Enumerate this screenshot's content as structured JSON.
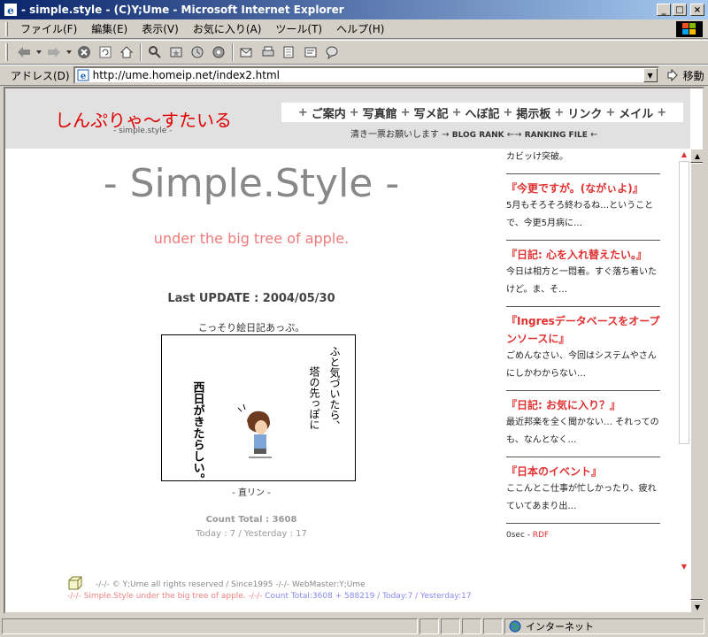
{
  "window": {
    "title": "- simple.style - (C)Y;Ume - Microsoft Internet Explorer",
    "min_label": "_",
    "max_label": "□",
    "close_label": "×"
  },
  "menu": {
    "items": [
      "ファイル(F)",
      "編集(E)",
      "表示(V)",
      "お気に入り(A)",
      "ツール(T)",
      "ヘルプ(H)"
    ]
  },
  "toolbar": {
    "icons": [
      "back-icon",
      "forward-icon",
      "stop-icon",
      "refresh-icon",
      "home-icon",
      "search-icon",
      "favorites-icon",
      "history-icon",
      "media-icon",
      "mail-icon",
      "print-icon",
      "edit-icon",
      "discuss-icon",
      "messenger-icon"
    ]
  },
  "address": {
    "label": "アドレス(D)",
    "url": "http://ume.homeip.net/index2.html",
    "go_label": "移動"
  },
  "site": {
    "logo": "しんぷりゃ〜すたいる",
    "logo_sub": "- simple.style -",
    "nav": [
      "+",
      "ご案内",
      "+",
      "写真館",
      "+",
      "写メ記",
      "+",
      "へぼ記",
      "+",
      "掲示板",
      "+",
      "リンク",
      "+",
      "メイル",
      "+"
    ],
    "header_line": "清き一票お願いします →",
    "blog_rank": "BLOG RANK",
    "arrow_mid": "←→",
    "ranking_file": "RANKING FILE",
    "arrow_end": "←"
  },
  "main": {
    "big_title": "- Simple.Style -",
    "subtitle": "under the big tree of apple.",
    "last_update": "Last UPDATE : 2004/05/30",
    "caption_top": "こっそり絵日記あっぷ。",
    "image_text_left": "西日がきたらしい。",
    "image_text_right1": "ふと気づいたら、",
    "image_text_right2": "塔の先っぽに",
    "caption_bottom": "- 直リン -",
    "count_total": "Count Total : 3608",
    "count_sub": "Today : 7 / Yesterday : 17"
  },
  "footer": {
    "line1": "-/-/- © Y;Ume all rights reserved / Since1995 -/-/- WebMaster:Y;Ume",
    "line2_pink": "-/-/- Simple.Style under the big tree of apple. -/-/-",
    "line2_blue": "Count Total:3608 + 588219 / Today:7 / Yesterday:17"
  },
  "sidebar": {
    "first_body": "カビッけ突破。",
    "entries": [
      {
        "title": "『今更ですが。(ながぃよ)』",
        "body": "5月もそろそろ終わるね…ということで、今更5月病に…"
      },
      {
        "title": "『日記: 心を入れ替えたい。』",
        "body": "今日は相方と一悶着。すぐ落ち着いたけど。ま、そ…"
      },
      {
        "title": "『Ingresデータベースをオープンソースに』",
        "body": "ごめんなさい、今回はシステムやさんにしかわからない…"
      },
      {
        "title": "『日記: お気に入り？』",
        "body": "最近邦楽を全く聞かない… それってのも、なんとなく…"
      },
      {
        "title": "『日本のイベント』",
        "body": "ここんとこ仕事が忙しかったり、疲れていてあまり出…"
      }
    ],
    "footer_text": "0sec - ",
    "footer_link": "RDF"
  },
  "status": {
    "zone_label": "インターネット"
  }
}
